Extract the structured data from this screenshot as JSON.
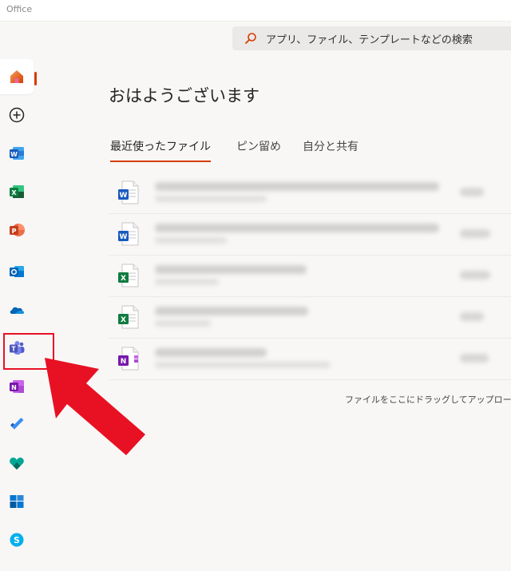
{
  "window": {
    "title": "Office"
  },
  "search": {
    "placeholder": "アプリ、ファイル、テンプレートなどの検索",
    "icon": "search-icon"
  },
  "sidebar": {
    "items": [
      {
        "name": "home",
        "icon": "home-icon",
        "active": true
      },
      {
        "name": "create",
        "icon": "plus-circle-icon"
      },
      {
        "name": "word",
        "icon": "word-icon",
        "color": "#185abd"
      },
      {
        "name": "excel",
        "icon": "excel-icon",
        "color": "#107c41"
      },
      {
        "name": "powerpoint",
        "icon": "powerpoint-icon",
        "color": "#c43e1c"
      },
      {
        "name": "outlook",
        "icon": "outlook-icon",
        "color": "#0078d4"
      },
      {
        "name": "onedrive",
        "icon": "onedrive-icon",
        "color": "#0364b8"
      },
      {
        "name": "teams",
        "icon": "teams-icon",
        "color": "#5b5fc7"
      },
      {
        "name": "onenote",
        "icon": "onenote-icon",
        "color": "#7719aa"
      },
      {
        "name": "todo",
        "icon": "todo-icon",
        "color": "#2564cf"
      },
      {
        "name": "family-safety",
        "icon": "family-safety-icon",
        "color": "#00a693"
      },
      {
        "name": "microsoft-store",
        "icon": "store-icon",
        "color": "#0078d4"
      },
      {
        "name": "skype",
        "icon": "skype-icon",
        "color": "#00aff0"
      }
    ]
  },
  "main": {
    "greeting": "おはようございます",
    "tabs": [
      {
        "label": "最近使ったファイル",
        "active": true
      },
      {
        "label": "ピン留め"
      },
      {
        "label": "自分と共有"
      }
    ],
    "files": [
      {
        "type": "word"
      },
      {
        "type": "word"
      },
      {
        "type": "excel"
      },
      {
        "type": "excel"
      },
      {
        "type": "onenote"
      }
    ],
    "upload_hint": "ファイルをここにドラッグしてアップロー"
  },
  "colors": {
    "accent": "#d83b01",
    "annotation": "#e81123"
  }
}
